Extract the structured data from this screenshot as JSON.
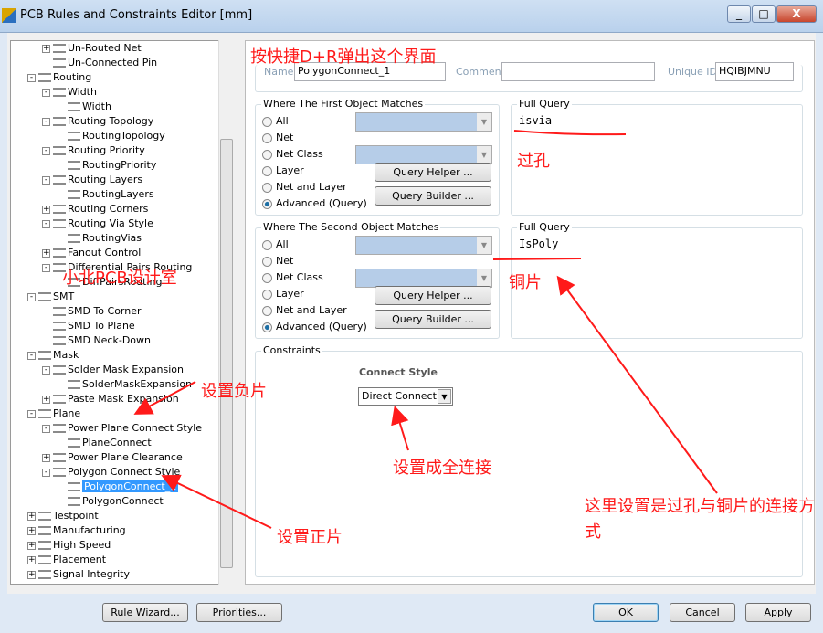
{
  "window": {
    "title": "PCB Rules and Constraints Editor [mm]",
    "min": "_",
    "max": "□",
    "close": "X"
  },
  "tree": [
    {
      "label": "Un-Routed Net",
      "level": 2,
      "exp": "+"
    },
    {
      "label": "Un-Connected Pin",
      "level": 2,
      "exp": ""
    },
    {
      "label": "Routing",
      "level": 1,
      "exp": "-"
    },
    {
      "label": "Width",
      "level": 2,
      "exp": "-"
    },
    {
      "label": "Width",
      "level": 3,
      "exp": ""
    },
    {
      "label": "Routing Topology",
      "level": 2,
      "exp": "-"
    },
    {
      "label": "RoutingTopology",
      "level": 3,
      "exp": ""
    },
    {
      "label": "Routing Priority",
      "level": 2,
      "exp": "-"
    },
    {
      "label": "RoutingPriority",
      "level": 3,
      "exp": ""
    },
    {
      "label": "Routing Layers",
      "level": 2,
      "exp": "-"
    },
    {
      "label": "RoutingLayers",
      "level": 3,
      "exp": ""
    },
    {
      "label": "Routing Corners",
      "level": 2,
      "exp": "+"
    },
    {
      "label": "Routing Via Style",
      "level": 2,
      "exp": "-"
    },
    {
      "label": "RoutingVias",
      "level": 3,
      "exp": ""
    },
    {
      "label": "Fanout Control",
      "level": 2,
      "exp": "+"
    },
    {
      "label": "Differential Pairs Routing",
      "level": 2,
      "exp": "-"
    },
    {
      "label": "DiffPairsRouting",
      "level": 3,
      "exp": ""
    },
    {
      "label": "SMT",
      "level": 1,
      "exp": "-"
    },
    {
      "label": "SMD To Corner",
      "level": 2,
      "exp": ""
    },
    {
      "label": "SMD To Plane",
      "level": 2,
      "exp": ""
    },
    {
      "label": "SMD Neck-Down",
      "level": 2,
      "exp": ""
    },
    {
      "label": "Mask",
      "level": 1,
      "exp": "-"
    },
    {
      "label": "Solder Mask Expansion",
      "level": 2,
      "exp": "-"
    },
    {
      "label": "SolderMaskExpansion",
      "level": 3,
      "exp": ""
    },
    {
      "label": "Paste Mask Expansion",
      "level": 2,
      "exp": "+"
    },
    {
      "label": "Plane",
      "level": 1,
      "exp": "-"
    },
    {
      "label": "Power Plane Connect Style",
      "level": 2,
      "exp": "-"
    },
    {
      "label": "PlaneConnect",
      "level": 3,
      "exp": ""
    },
    {
      "label": "Power Plane Clearance",
      "level": 2,
      "exp": "+"
    },
    {
      "label": "Polygon Connect Style",
      "level": 2,
      "exp": "-"
    },
    {
      "label": "PolygonConnect_1",
      "level": 3,
      "exp": "",
      "selected": true
    },
    {
      "label": "PolygonConnect",
      "level": 3,
      "exp": ""
    },
    {
      "label": "Testpoint",
      "level": 1,
      "exp": "+"
    },
    {
      "label": "Manufacturing",
      "level": 1,
      "exp": "+"
    },
    {
      "label": "High Speed",
      "level": 1,
      "exp": "+"
    },
    {
      "label": "Placement",
      "level": 1,
      "exp": "+"
    },
    {
      "label": "Signal Integrity",
      "level": 1,
      "exp": "+"
    }
  ],
  "rule": {
    "name_label": "Name",
    "name": "PolygonConnect_1",
    "comment_label": "Comment",
    "comment": "",
    "uid_label": "Unique ID",
    "uid": "HQIBJMNU"
  },
  "first": {
    "caption": "Where The First Object Matches",
    "options": [
      "All",
      "Net",
      "Net Class",
      "Layer",
      "Net and Layer",
      "Advanced (Query)"
    ],
    "selected": "Advanced (Query)",
    "query_caption": "Full Query",
    "query": "isvia"
  },
  "second": {
    "caption": "Where The Second Object Matches",
    "options": [
      "All",
      "Net",
      "Net Class",
      "Layer",
      "Net and Layer",
      "Advanced (Query)"
    ],
    "selected": "Advanced (Query)",
    "query_caption": "Full Query",
    "query": "IsPoly"
  },
  "buttons": {
    "helper": "Query Helper ...",
    "builder": "Query Builder ...",
    "rule_wizard": "Rule Wizard...",
    "priorities": "Priorities...",
    "ok": "OK",
    "cancel": "Cancel",
    "apply": "Apply"
  },
  "constraints": {
    "caption": "Constraints",
    "connect_style_label": "Connect Style",
    "connect_style": "Direct Connect"
  },
  "annotations": {
    "top": "按快捷D+R弹出这个界面",
    "via": "过孔",
    "copper": "铜片",
    "watermark": "小北PCB设计室",
    "negative": "设置负片",
    "full_connect": "设置成全连接",
    "positive": "设置正片",
    "explain": "这里设置是过孔与铜片的连接方式"
  },
  "colors": {
    "annotation": "#ff1a1a",
    "selection": "#3399ff"
  }
}
